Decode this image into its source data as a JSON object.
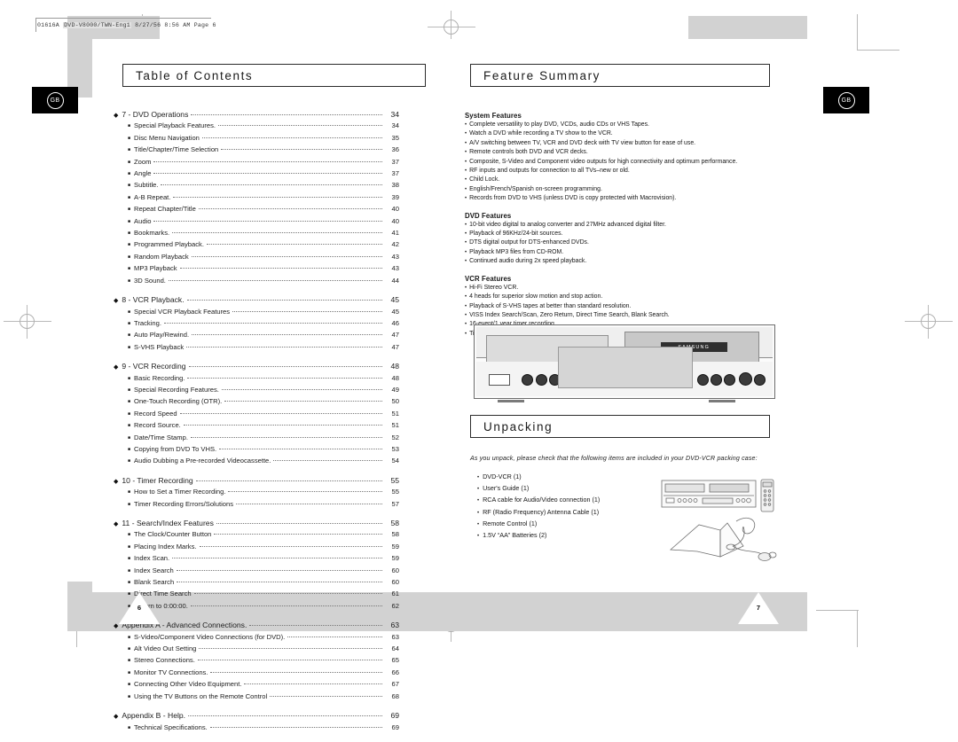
{
  "document": {
    "slug_prefix": "01616A",
    "slug_boxed": "DVD-V8000/TWN-Eng1",
    "slug_date": "8/27/56",
    "slug_time": "8:56 AM",
    "slug_page": "Page 6",
    "region_badge": "GB"
  },
  "left_page": {
    "page_number": "6",
    "title": "Table of Contents",
    "groups": [
      {
        "heading": {
          "label": "7 - DVD Operations",
          "page": "34"
        },
        "items": [
          {
            "label": "Special Playback Features.",
            "page": "34"
          },
          {
            "label": "Disc Menu Navigation",
            "page": "35"
          },
          {
            "label": "Title/Chapter/Time Selection",
            "page": "36"
          },
          {
            "label": "Zoom",
            "page": "37"
          },
          {
            "label": "Angle",
            "page": "37"
          },
          {
            "label": "Subtitle.",
            "page": "38"
          },
          {
            "label": "A-B Repeat.",
            "page": "39"
          },
          {
            "label": "Repeat Chapter/Title",
            "page": "40"
          },
          {
            "label": "Audio",
            "page": "40"
          },
          {
            "label": "Bookmarks.",
            "page": "41"
          },
          {
            "label": "Programmed Playback.",
            "page": "42"
          },
          {
            "label": "Random Playback",
            "page": "43"
          },
          {
            "label": "MP3 Playback",
            "page": "43"
          },
          {
            "label": "3D Sound.",
            "page": "44"
          }
        ]
      },
      {
        "heading": {
          "label": "8 - VCR Playback.",
          "page": "45"
        },
        "items": [
          {
            "label": "Special VCR Playback Features",
            "page": "45"
          },
          {
            "label": "Tracking.",
            "page": "46"
          },
          {
            "label": "Auto Play/Rewind.",
            "page": "47"
          },
          {
            "label": "S-VHS Playback",
            "page": "47"
          }
        ]
      },
      {
        "heading": {
          "label": "9 - VCR Recording",
          "page": "48"
        },
        "items": [
          {
            "label": "Basic Recording.",
            "page": "48"
          },
          {
            "label": "Special Recording Features.",
            "page": "49"
          },
          {
            "label": "One-Touch Recording (OTR).",
            "page": "50"
          },
          {
            "label": "Record Speed",
            "page": "51"
          },
          {
            "label": "Record Source.",
            "page": "51"
          },
          {
            "label": "Date/Time Stamp.",
            "page": "52"
          },
          {
            "label": "Copying from DVD To VHS.",
            "page": "53"
          },
          {
            "label": "Audio Dubbing a Pre-recorded Videocassette.",
            "page": "54"
          }
        ]
      },
      {
        "heading": {
          "label": "10 - Timer Recording",
          "page": "55"
        },
        "items": [
          {
            "label": "How to Set a Timer Recording.",
            "page": "55"
          },
          {
            "label": "Timer Recording Errors/Solutions",
            "page": "57"
          }
        ]
      },
      {
        "heading": {
          "label": "11 - Search/Index Features",
          "page": "58"
        },
        "items": [
          {
            "label": "The Clock/Counter Button",
            "page": "58"
          },
          {
            "label": "Placing Index Marks.",
            "page": "59"
          },
          {
            "label": "Index Scan.",
            "page": "59"
          },
          {
            "label": "Index Search",
            "page": "60"
          },
          {
            "label": "Blank Search",
            "page": "60"
          },
          {
            "label": "Direct Time Search",
            "page": "61"
          },
          {
            "label": "Return to 0:00:00.",
            "page": "62"
          }
        ]
      },
      {
        "heading": {
          "label": "Appendix A - Advanced Connections.",
          "page": "63"
        },
        "items": [
          {
            "label": "S-Video/Component Video Connections (for DVD).",
            "page": "63"
          },
          {
            "label": "Alt Video Out Setting",
            "page": "64"
          },
          {
            "label": "Stereo Connections.",
            "page": "65"
          },
          {
            "label": "Monitor TV Connections.",
            "page": "66"
          },
          {
            "label": "Connecting Other Video Equipment.",
            "page": "67"
          },
          {
            "label": "Using the TV Buttons on the Remote Control",
            "page": "68"
          }
        ]
      },
      {
        "heading": {
          "label": "Appendix B - Help.",
          "page": "69"
        },
        "items": [
          {
            "label": "Technical Specifications.",
            "page": "69"
          }
        ]
      }
    ]
  },
  "right_page": {
    "page_number": "7",
    "feature_summary": {
      "title": "Feature Summary",
      "sections": [
        {
          "heading": "System Features",
          "items": [
            "Complete versatility to play DVD, VCDs, audio CDs or VHS Tapes.",
            "Watch a DVD while recording a TV show to the VCR.",
            "A/V switching between TV, VCR and DVD deck with TV view button for ease of use.",
            "Remote controls both DVD and VCR decks.",
            "Composite, S-Video and Component video outputs for high connectivity and optimum performance.",
            "RF inputs and outputs for connection to all TVs–new or old.",
            "Child Lock.",
            "English/French/Spanish on-screen programming.",
            "Records from DVD to VHS (unless DVD is copy protected with Macrovision)."
          ]
        },
        {
          "heading": "DVD Features",
          "items": [
            "10-bit video digital to analog converter and 27MHz advanced digital filter.",
            "Playback of 96KHz/24-bit sources.",
            "DTS digital output for DTS-enhanced DVDs.",
            "Playback MP3 files from CD-ROM.",
            "Continued audio during 2x speed playback."
          ]
        },
        {
          "heading": "VCR Features",
          "items": [
            "Hi-Fi Stereo VCR.",
            "4 heads for superior slow motion and stop action.",
            "Playback of S-VHS tapes at better than standard resolution.",
            "VISS Index Search/Scan, Zero Return, Direct Time Search, Blank Search.",
            "16-event/1 year timer recording.",
            "Time remaining counter, real time counter."
          ]
        }
      ],
      "device_brand": "SAMSUNG"
    },
    "unpacking": {
      "title": "Unpacking",
      "intro": "As you unpack, please check that the following items are included in your DVD-VCR packing case:",
      "items": [
        "DVD-VCR (1)",
        "User's Guide (1)",
        "RCA cable for Audio/Video connection (1)",
        "RF (Radio Frequency) Antenna Cable (1)",
        "Remote Control (1)",
        "1.5V “AA” Batteries (2)"
      ]
    }
  }
}
